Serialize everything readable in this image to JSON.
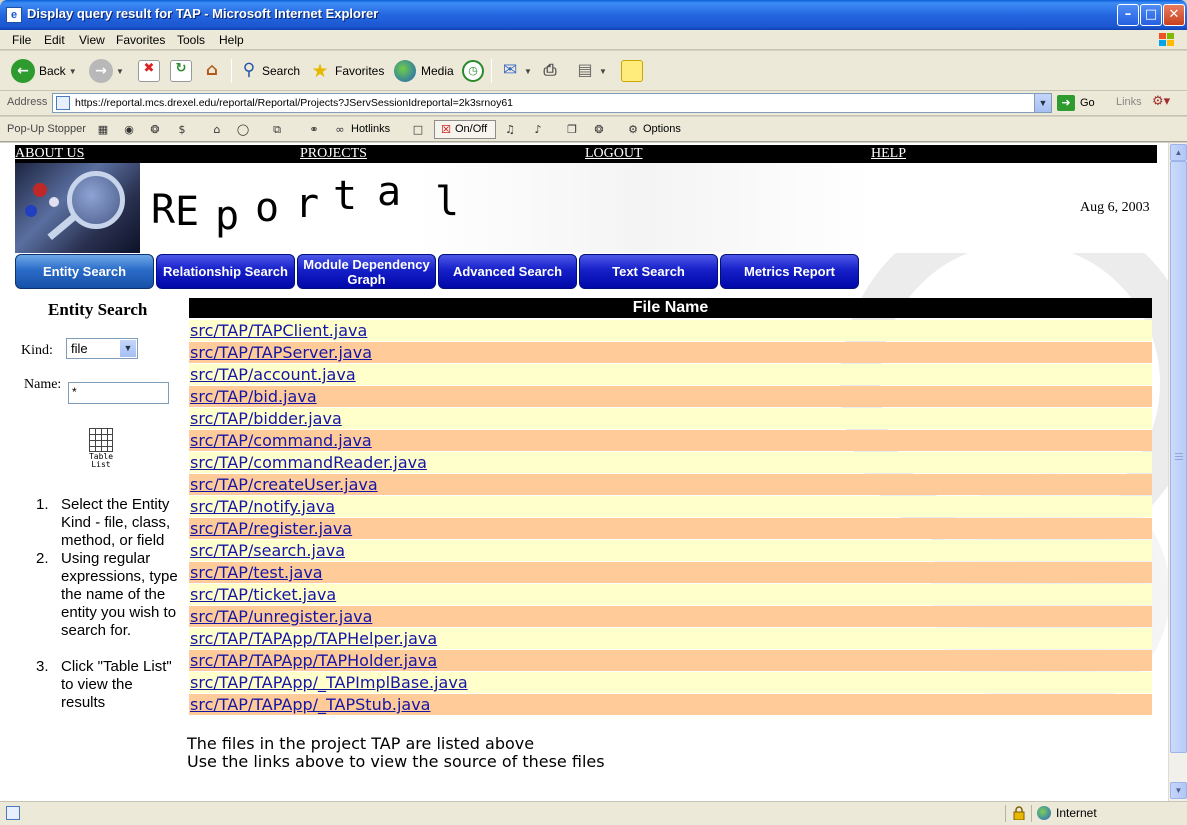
{
  "window": {
    "title": "Display query result for TAP - Microsoft Internet Explorer",
    "minimize": "–",
    "maximize": "□",
    "close": "✕"
  },
  "menu": [
    "File",
    "Edit",
    "View",
    "Favorites",
    "Tools",
    "Help"
  ],
  "toolbar": {
    "back": "Back",
    "search": "Search",
    "favorites": "Favorites",
    "media": "Media"
  },
  "address": {
    "label": "Address",
    "url": "https://reportal.mcs.drexel.edu/reportal/Reportal/Projects?JServSessionIdreportal=2k3srnoy61",
    "go": "Go",
    "links": "Links"
  },
  "popup_stopper": {
    "label": "Pop-Up Stopper",
    "hotlinks": "Hotlinks",
    "onoff": "On/Off",
    "options": "Options"
  },
  "site_nav": [
    "ABOUT US",
    "PROJECTS",
    "LOGOUT",
    "HELP"
  ],
  "banner": {
    "wordmark": [
      "R",
      "E",
      "p",
      "o",
      "r",
      "t",
      "a",
      "l"
    ],
    "date": "Aug 6, 2003"
  },
  "tabs": [
    {
      "label": "Entity Search",
      "active": true
    },
    {
      "label": "Relationship Search",
      "active": false
    },
    {
      "label": "Module Dependency Graph",
      "active": false
    },
    {
      "label": "Advanced Search",
      "active": false
    },
    {
      "label": "Text Search",
      "active": false
    },
    {
      "label": "Metrics Report",
      "active": false
    }
  ],
  "sidebar": {
    "title": "Entity Search",
    "kind_label": "Kind:",
    "kind_value": "file",
    "name_label": "Name:",
    "name_value": "*",
    "table_list_caption": "Table List",
    "steps": [
      {
        "n": "1.",
        "text": "Select the Entity Kind - file, class, method, or field"
      },
      {
        "n": "2.",
        "text": "Using regular expressions, type the name of the entity you wish to search for."
      },
      {
        "n": "3.",
        "text": "Click \"Table List\" to view the results"
      }
    ]
  },
  "file_table": {
    "header": "File Name",
    "rows": [
      "src/TAP/TAPClient.java",
      "src/TAP/TAPServer.java",
      "src/TAP/account.java",
      "src/TAP/bid.java",
      "src/TAP/bidder.java",
      "src/TAP/command.java",
      "src/TAP/commandReader.java",
      "src/TAP/createUser.java",
      "src/TAP/notify.java",
      "src/TAP/register.java",
      "src/TAP/search.java",
      "src/TAP/test.java",
      "src/TAP/ticket.java",
      "src/TAP/unregister.java",
      "src/TAP/TAPApp/TAPHelper.java",
      "src/TAP/TAPApp/TAPHolder.java",
      "src/TAP/TAPApp/_TAPImplBase.java",
      "src/TAP/TAPApp/_TAPStub.java"
    ],
    "row_colors": [
      "#ffffcc",
      "#ffcc99"
    ]
  },
  "footnote": [
    "The files in the project TAP are listed above",
    "Use the links above to view the source of these files"
  ],
  "status": {
    "zone": "Internet"
  }
}
